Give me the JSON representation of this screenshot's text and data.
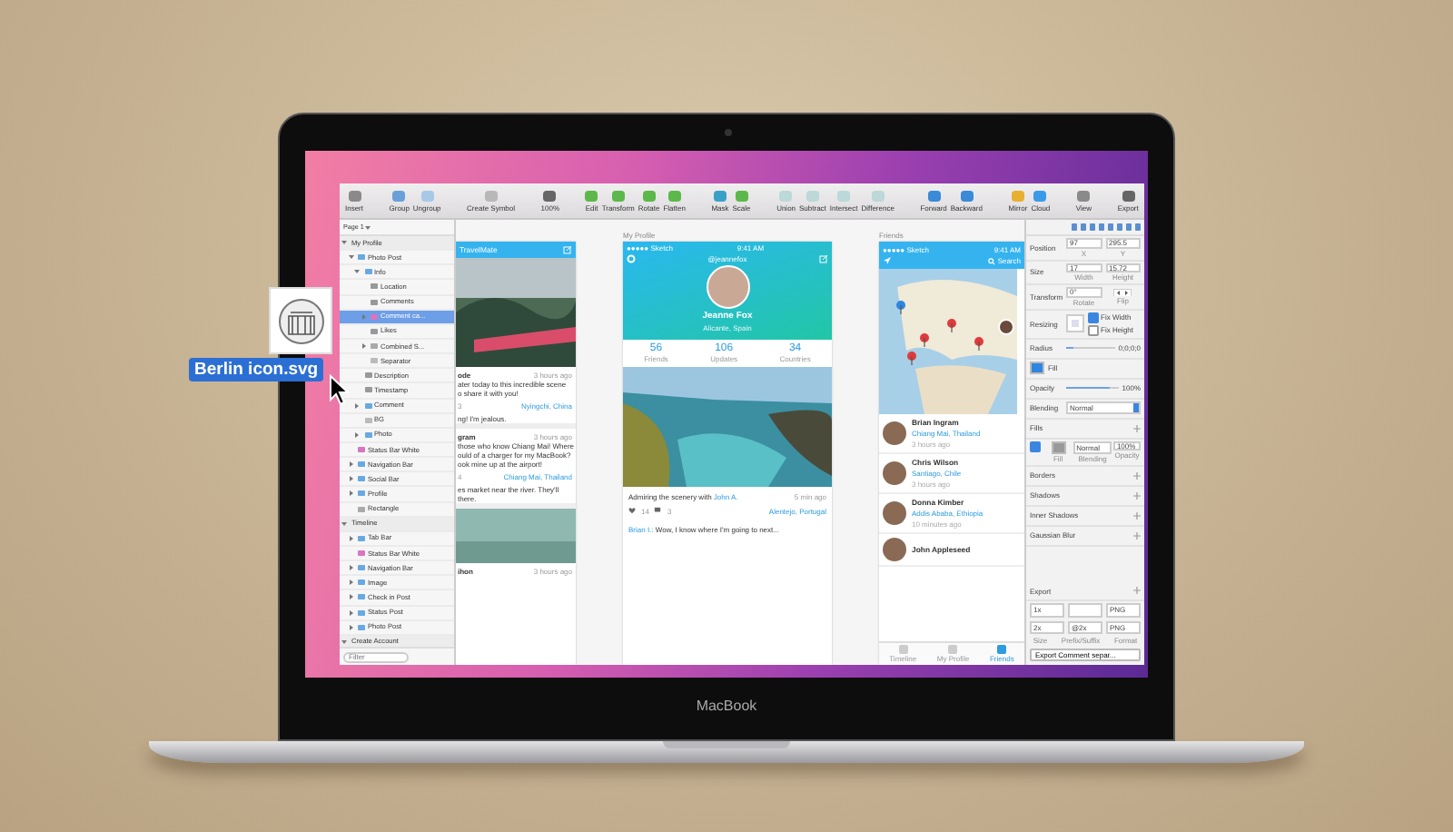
{
  "dragged_file": {
    "name": "Berlin icon.svg"
  },
  "toolbar": {
    "groups": [
      [
        {
          "label": "Insert",
          "color": "#8a8a8a"
        }
      ],
      [
        {
          "label": "Group",
          "color": "#6aa0d8"
        },
        {
          "label": "Ungroup",
          "color": "#a8c8e8"
        }
      ],
      [
        {
          "label": "Create Symbol",
          "color": "#b8b8b8"
        }
      ],
      [
        {
          "label": "100%",
          "color": "#666666"
        }
      ],
      [
        {
          "label": "Edit",
          "color": "#5cb84a"
        },
        {
          "label": "Transform",
          "color": "#5cb84a"
        },
        {
          "label": "Rotate",
          "color": "#5cb84a"
        },
        {
          "label": "Flatten",
          "color": "#5cb84a"
        }
      ],
      [
        {
          "label": "Mask",
          "color": "#3aa0c8"
        },
        {
          "label": "Scale",
          "color": "#5cb84a"
        }
      ],
      [
        {
          "label": "Union",
          "color": "#bcd8d8"
        },
        {
          "label": "Subtract",
          "color": "#bcd8d8"
        },
        {
          "label": "Intersect",
          "color": "#bcd8d8"
        },
        {
          "label": "Difference",
          "color": "#bcd8d8"
        }
      ],
      [
        {
          "label": "Forward",
          "color": "#3a8ad8"
        },
        {
          "label": "Backward",
          "color": "#3a8ad8"
        }
      ],
      [
        {
          "label": "Mirror",
          "color": "#e8b030"
        },
        {
          "label": "Cloud",
          "color": "#3a9ae8"
        }
      ],
      [
        {
          "label": "View",
          "color": "#8a8a8a"
        }
      ],
      [
        {
          "label": "Export",
          "color": "#666666"
        }
      ]
    ]
  },
  "layers": {
    "page": "Page 1",
    "filter_placeholder": "Filter",
    "items": [
      {
        "name": "My Profile",
        "kind": "artboard",
        "expanded": true,
        "selected": false,
        "children": [
          {
            "name": "Photo Post",
            "kind": "group",
            "expanded": true,
            "selected": false,
            "children": [
              {
                "name": "Info",
                "kind": "group",
                "expanded": true,
                "selected": false,
                "children": [
                  {
                    "name": "Location",
                    "kind": "text",
                    "selected": false
                  },
                  {
                    "name": "Comments",
                    "kind": "text",
                    "selected": false
                  },
                  {
                    "name": "Comment ca...",
                    "kind": "symbol",
                    "expanded": false,
                    "selected": true
                  },
                  {
                    "name": "Likes",
                    "kind": "text",
                    "selected": false
                  },
                  {
                    "name": "Combined S...",
                    "kind": "shape",
                    "expanded": false,
                    "selected": false
                  },
                  {
                    "name": "Separator",
                    "kind": "line",
                    "selected": false
                  }
                ]
              },
              {
                "name": "Description",
                "kind": "text",
                "selected": false
              },
              {
                "name": "Timestamp",
                "kind": "text",
                "selected": false
              },
              {
                "name": "Comment",
                "kind": "group",
                "expanded": false,
                "selected": false
              },
              {
                "name": "BG",
                "kind": "line",
                "selected": false
              },
              {
                "name": "Photo",
                "kind": "group",
                "expanded": false,
                "selected": false
              }
            ]
          },
          {
            "name": "Status Bar White",
            "kind": "symbol",
            "selected": false
          },
          {
            "name": "Navigation Bar",
            "kind": "group",
            "expanded": false,
            "selected": false
          },
          {
            "name": "Social Bar",
            "kind": "group",
            "expanded": false,
            "selected": false
          },
          {
            "name": "Profile",
            "kind": "group",
            "expanded": false,
            "selected": false
          },
          {
            "name": "Rectangle",
            "kind": "shape",
            "selected": false
          }
        ]
      },
      {
        "name": "Timeline",
        "kind": "artboard",
        "expanded": true,
        "selected": false,
        "children": [
          {
            "name": "Tab Bar",
            "kind": "group",
            "expanded": false,
            "selected": false
          },
          {
            "name": "Status Bar White",
            "kind": "symbol",
            "selected": false
          },
          {
            "name": "Navigation Bar",
            "kind": "group",
            "expanded": false,
            "selected": false
          },
          {
            "name": "Image",
            "kind": "group",
            "expanded": false,
            "selected": false
          },
          {
            "name": "Check in Post",
            "kind": "group",
            "expanded": false,
            "selected": false
          },
          {
            "name": "Status Post",
            "kind": "group",
            "expanded": false,
            "selected": false
          },
          {
            "name": "Photo Post",
            "kind": "group",
            "expanded": false,
            "selected": false
          }
        ]
      },
      {
        "name": "Create Account",
        "kind": "artboard",
        "expanded": true,
        "selected": false
      }
    ]
  },
  "artboards": [
    {
      "kind": "feed",
      "title": "TravelMate",
      "posts": [
        {
          "user": "ode",
          "time": "3 hours ago",
          "lines": [
            "ater today to this incredible scene",
            "o share it with you!"
          ],
          "count": "3",
          "place": "Nyingchi, China",
          "comment": [
            "ng! I'm jealous."
          ]
        },
        {
          "user": "gram",
          "time": "3 hours ago",
          "lines": [
            "those who know Chiang Mai! Where",
            "ould of a charger for my MacBook?",
            "ook mine up at the airport!"
          ],
          "count": "4",
          "place": "Chiang Mai, Thailand",
          "comment": [
            "es market near the river. They'll",
            "there."
          ]
        }
      ],
      "last": {
        "user": "ihon",
        "time": "3 hours ago"
      }
    },
    {
      "kind": "profile",
      "label": "My Profile",
      "carrier": "●●●●● Sketch",
      "time": "9:41 AM",
      "handle": "@jeannefox",
      "name": "Jeanne Fox",
      "location": "Alicante, Spain",
      "stats": [
        {
          "value": "56",
          "label": "Friends"
        },
        {
          "value": "106",
          "label": "Updates"
        },
        {
          "value": "34",
          "label": "Countries"
        }
      ],
      "post": {
        "caption": "Admiring the scenery with ",
        "mention": "John A.",
        "time": "5 min ago",
        "likes": "14",
        "comments": "3",
        "place": "Alentejo, Portugal",
        "comment_user": "Brian I.:",
        "comment": "Wow, I know where I'm going to next..."
      }
    },
    {
      "kind": "friends",
      "label": "Friends",
      "carrier": "●●●●● Sketch",
      "time": "9:41 AM",
      "search": "Search",
      "friends": [
        {
          "name": "Brian Ingram",
          "place": "Chiang Mai, Thailand",
          "time": "3 hours ago"
        },
        {
          "name": "Chris Wilson",
          "place": "Santiago, Chile",
          "time": "3 hours ago"
        },
        {
          "name": "Donna Kimber",
          "place": "Addis Ababa, Ethiopia",
          "time": "10 minutes ago"
        },
        {
          "name": "John Appleseed"
        }
      ],
      "tabs": [
        {
          "label": "Timeline",
          "selected": false
        },
        {
          "label": "My Profile",
          "selected": false
        },
        {
          "label": "Friends",
          "selected": true
        }
      ]
    }
  ],
  "inspector": {
    "rows": [
      {
        "kind": "pair",
        "label": "Position",
        "fields": [
          {
            "value": "97",
            "caption": "X"
          },
          {
            "value": "295.5",
            "caption": "Y"
          }
        ]
      },
      {
        "kind": "pair",
        "label": "Size",
        "fields": [
          {
            "value": "17",
            "caption": "Width"
          },
          {
            "value": "15.72",
            "caption": "Height"
          }
        ]
      },
      {
        "kind": "pair",
        "label": "Transform",
        "fields": [
          {
            "value": "0°",
            "caption": "Rotate"
          },
          {
            "caption": "Flip"
          }
        ]
      },
      {
        "kind": "resizing",
        "label": "Resizing",
        "options": [
          {
            "label": "Fix Width",
            "checked": true
          },
          {
            "label": "Fix Height",
            "checked": false
          }
        ]
      },
      {
        "kind": "slider",
        "label": "Radius",
        "level": 0.15,
        "reading": "0;0;0;0"
      },
      {
        "kind": "swatch",
        "label": "Fill",
        "color": "#2f86e0"
      },
      {
        "kind": "slider",
        "label": "Opacity",
        "level": 0.85,
        "reading": "100%"
      },
      {
        "kind": "select",
        "label": "Blending",
        "value": "Normal"
      },
      {
        "kind": "section",
        "label": "Fills"
      },
      {
        "kind": "fill",
        "checked": true,
        "color": "#9a9a9a",
        "blending": "Normal",
        "opacity": "100%",
        "captions": [
          "Fill",
          "Blending",
          "Opacity"
        ]
      },
      {
        "kind": "section",
        "label": "Borders"
      },
      {
        "kind": "section",
        "label": "Shadows"
      },
      {
        "kind": "section",
        "label": "Inner Shadows"
      },
      {
        "kind": "section",
        "label": "Gaussian Blur"
      }
    ],
    "export": {
      "title": "Export",
      "rows": [
        {
          "size": "1x",
          "format": "PNG"
        },
        {
          "size": "2x",
          "suffix": "@2x",
          "format": "PNG"
        }
      ],
      "captions": [
        "Size",
        "Prefix/Suffix",
        "Format"
      ],
      "button": "Export Comment separ..."
    }
  },
  "laptop": {
    "label": "MacBook"
  }
}
